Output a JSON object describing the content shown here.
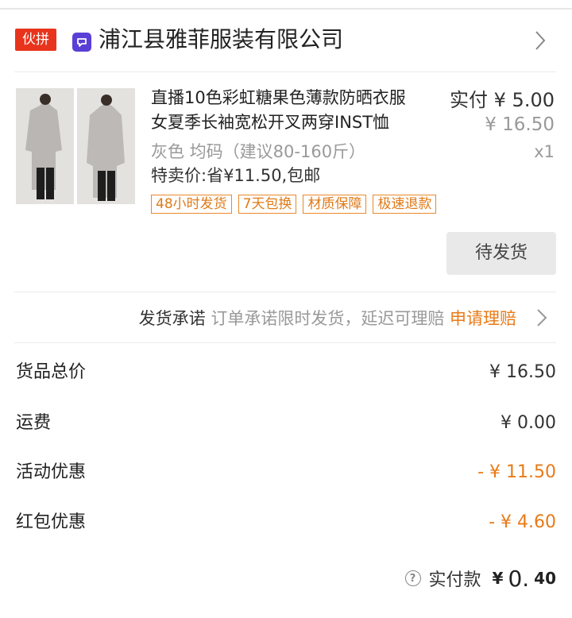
{
  "store": {
    "badge": "伙拼",
    "logo_icon": "shop-logo-icon",
    "name": "浦江县雅菲服装有限公司",
    "accent": "#e8341c"
  },
  "product": {
    "title_line1": "直播10色彩虹糖果色薄款防晒衣服",
    "title_line2": "女夏季长袖宽松开叉两穿INST恤",
    "paid_price": "实付 ¥ 5.00",
    "original_price": "¥ 16.50",
    "spec": "灰色  均码（建议80-160斤）",
    "quantity": "x1",
    "promo": "特卖价:省¥11.50,包邮",
    "tags": [
      "48小时发货",
      "7天包换",
      "材质保障",
      "极速退款"
    ],
    "status_button": "待发货"
  },
  "commitment": {
    "label": "发货承诺",
    "desc": " 订单承诺限时发货，延迟可理赔 ",
    "link": "申请理赔"
  },
  "fees": [
    {
      "label": "货品总价",
      "value": "¥ 16.50"
    },
    {
      "label": "运费",
      "value": "¥ 0.00"
    },
    {
      "label": "活动优惠",
      "value": "- ¥ 11.50"
    },
    {
      "label": "红包优惠",
      "value": "- ¥ 4.60"
    }
  ],
  "total": {
    "help_icon": "?",
    "label": "实付款",
    "currency": "¥",
    "integer": "0.",
    "decimal": "40"
  },
  "colors": {
    "discount": "#e97a16",
    "tag_border": "#e8892a"
  }
}
